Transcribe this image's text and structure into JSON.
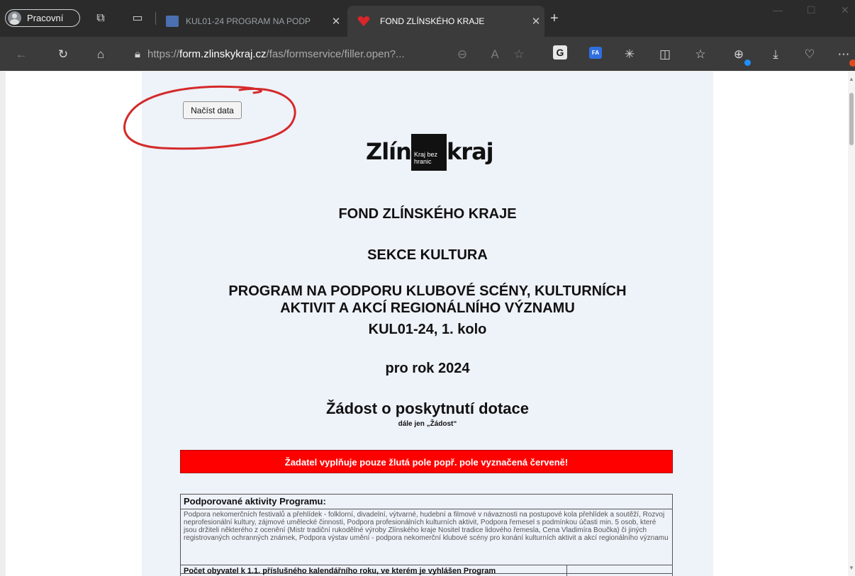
{
  "browser": {
    "profile_label": "Pracovní",
    "tabs": [
      {
        "label": "KUL01-24 PROGRAM NA PODP",
        "active": false
      },
      {
        "label": "FOND ZLÍNSKÉHO KRAJE",
        "active": true
      }
    ],
    "url_host": "form.zlinskykraj.cz",
    "url_path": "/fas/formservice/filler.open?...",
    "url_prefix": "https://",
    "ext_g": "G",
    "ext_fa": "FA"
  },
  "page": {
    "load_button": "Načíst data",
    "logo_left": "Zlíns",
    "logo_box": "Kraj bez hranic",
    "logo_right": "kraj",
    "heading_fund": "FOND ZLÍNSKÉHO KRAJE",
    "heading_section": "SEKCE KULTURA",
    "program_line1": "PROGRAM NA PODPORU KLUBOVÉ SCÉNY, KULTURNÍCH",
    "program_line2": "AKTIVIT A AKCÍ REGIONÁLNÍHO VÝZNAMU",
    "program_code": "KUL01-24, 1. kolo",
    "year": "pro rok 2024",
    "request_title": "Žádost o poskytnutí dotace",
    "request_sub": "dále jen „Žádost“",
    "warning": "Žadatel vyplňuje pouze žlutá pole popř. pole vyznačená červeně!",
    "supported_title": "Podporované aktivity Programu:",
    "supported_text": "Podpora nekomerčních festivalů a přehlídek - folklorní, divadelní, výtvarné, hudební a filmové v návaznosti na postupové kola přehlídek a soutěží, Rozvoj neprofesionální kultury, zájmové umělecké činnosti, Podpora profesionálních kulturních aktivit, Podpora řemesel s podmínkou účasti min. 5 osob, které jsou držiteli některého z ocenění (Mistr tradiční rukodělné výroby Zlínského kraje Nositel tradice lidového řemesla, Cena Vladimíra Boučka) či jiných registrovaných ochranných známek, Podpora výstav umění - podpora nekomerční klubové scény pro konání kulturních aktivit a akcí regionálního významu",
    "population_label": "Počet obyvatel k 1.1. příslušného kalendářního roku, ve kterém je vyhlášen Program"
  },
  "colors": {
    "warning_bg": "#ff0000",
    "form_bg": "#eef2f9",
    "annotation": "#d42a2a"
  }
}
